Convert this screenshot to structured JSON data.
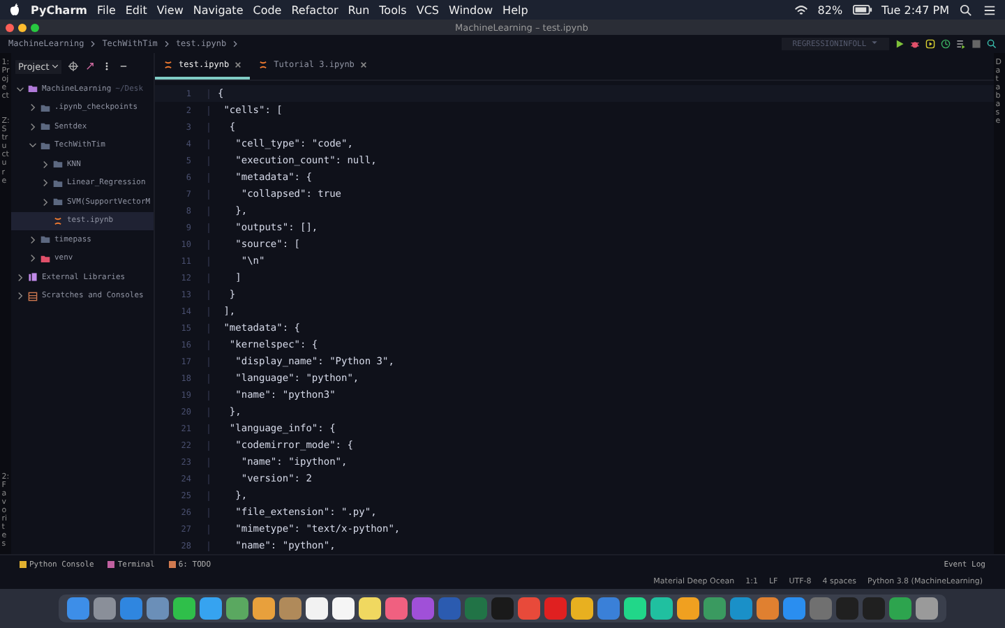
{
  "menu_bar": {
    "app": "PyCharm",
    "items": [
      "File",
      "Edit",
      "View",
      "Navigate",
      "Code",
      "Refactor",
      "Run",
      "Tools",
      "VCS",
      "Window",
      "Help"
    ],
    "battery": "82%",
    "clock": "Tue 2:47 PM"
  },
  "window": {
    "title": "MachineLearning – test.ipynb"
  },
  "breadcrumb": [
    "MachineLearning",
    "TechWithTim",
    "test.ipynb"
  ],
  "run_config": {
    "name": "REGRESSIONINFOLL"
  },
  "left_stripe": [
    "1: Project",
    "Z: Structure",
    "2: Favorites"
  ],
  "right_stripe": [
    "Database"
  ],
  "project_panel": {
    "title": "Project",
    "tree": [
      {
        "label": "MachineLearning",
        "hint": "~/Desk",
        "kind": "module",
        "expanded": true,
        "selected": false,
        "children": [
          {
            "label": ".ipynb_checkpoints",
            "kind": "folder",
            "expanded": false,
            "selected": false
          },
          {
            "label": "Sentdex",
            "kind": "folder",
            "expanded": false,
            "selected": false
          },
          {
            "label": "TechWithTim",
            "kind": "folder",
            "expanded": true,
            "selected": false,
            "children": [
              {
                "label": "KNN",
                "kind": "folder",
                "expanded": false,
                "selected": false
              },
              {
                "label": "Linear_Regression",
                "kind": "folder",
                "expanded": false,
                "selected": false
              },
              {
                "label": "SVM(SupportVectorM",
                "kind": "folder",
                "expanded": false,
                "selected": false
              },
              {
                "label": "test.ipynb",
                "kind": "notebook",
                "selected": true
              }
            ]
          },
          {
            "label": "timepass",
            "kind": "folder",
            "expanded": false,
            "selected": false
          },
          {
            "label": "venv",
            "kind": "venv",
            "expanded": false,
            "selected": false
          }
        ]
      },
      {
        "label": "External Libraries",
        "kind": "library",
        "expanded": false,
        "selected": false
      },
      {
        "label": "Scratches and Consoles",
        "kind": "scratches",
        "expanded": false,
        "selected": false
      }
    ]
  },
  "editor_tabs": [
    {
      "label": "test.ipynb",
      "selected": true
    },
    {
      "label": "Tutorial 3.ipynb",
      "selected": false
    }
  ],
  "code_lines": [
    {
      "number": "1",
      "text": "{"
    },
    {
      "number": "2",
      "text": " \"cells\": ["
    },
    {
      "number": "3",
      "text": "  {"
    },
    {
      "number": "4",
      "text": "   \"cell_type\": \"code\","
    },
    {
      "number": "5",
      "text": "   \"execution_count\": null,"
    },
    {
      "number": "6",
      "text": "   \"metadata\": {"
    },
    {
      "number": "7",
      "text": "    \"collapsed\": true"
    },
    {
      "number": "8",
      "text": "   },"
    },
    {
      "number": "9",
      "text": "   \"outputs\": [],"
    },
    {
      "number": "10",
      "text": "   \"source\": ["
    },
    {
      "number": "11",
      "text": "    \"\\n\""
    },
    {
      "number": "12",
      "text": "   ]"
    },
    {
      "number": "13",
      "text": "  }"
    },
    {
      "number": "14",
      "text": " ],"
    },
    {
      "number": "15",
      "text": " \"metadata\": {"
    },
    {
      "number": "16",
      "text": "  \"kernelspec\": {"
    },
    {
      "number": "17",
      "text": "   \"display_name\": \"Python 3\","
    },
    {
      "number": "18",
      "text": "   \"language\": \"python\","
    },
    {
      "number": "19",
      "text": "   \"name\": \"python3\""
    },
    {
      "number": "20",
      "text": "  },"
    },
    {
      "number": "21",
      "text": "  \"language_info\": {"
    },
    {
      "number": "22",
      "text": "   \"codemirror_mode\": {"
    },
    {
      "number": "23",
      "text": "    \"name\": \"ipython\","
    },
    {
      "number": "24",
      "text": "    \"version\": 2"
    },
    {
      "number": "25",
      "text": "   },"
    },
    {
      "number": "26",
      "text": "   \"file_extension\": \".py\","
    },
    {
      "number": "27",
      "text": "   \"mimetype\": \"text/x-python\","
    },
    {
      "number": "28",
      "text": "   \"name\": \"python\","
    }
  ],
  "tool_tabs": [
    {
      "label": "Python Console",
      "kind": "console"
    },
    {
      "label": "Terminal",
      "kind": "terminal"
    },
    {
      "label": "6: TODO",
      "kind": "todo"
    }
  ],
  "event_log": "Event Log",
  "status_bar": [
    "Material Deep Ocean",
    "1:1",
    "LF",
    "UTF-8",
    "4 spaces",
    "Python 3.8 (MachineLearning)"
  ],
  "dock": [
    {
      "color": "#3d8ee8"
    },
    {
      "color": "#8a8f99"
    },
    {
      "color": "#2f86e0"
    },
    {
      "color": "#6b8fb8"
    },
    {
      "color": "#2fbf4a"
    },
    {
      "color": "#36a3f0"
    },
    {
      "color": "#5aa860"
    },
    {
      "color": "#e8a03c"
    },
    {
      "color": "#b08a5a"
    },
    {
      "color": "#f2f2f2"
    },
    {
      "color": "#f5f5f5"
    },
    {
      "color": "#f0d860"
    },
    {
      "color": "#f06080"
    },
    {
      "color": "#a050d8"
    },
    {
      "color": "#2b5bb0"
    },
    {
      "color": "#217346"
    },
    {
      "color": "#1a1a1a"
    },
    {
      "color": "#e84a3a"
    },
    {
      "color": "#e02020"
    },
    {
      "color": "#e8b020"
    },
    {
      "color": "#3a80d8"
    },
    {
      "color": "#21d789"
    },
    {
      "color": "#20c0a0"
    },
    {
      "color": "#f0a020"
    },
    {
      "color": "#3a9a60"
    },
    {
      "color": "#1a90c8"
    },
    {
      "color": "#e08030"
    },
    {
      "color": "#2a8ef0"
    },
    {
      "color": "#707070"
    },
    {
      "color": "#202020"
    },
    {
      "color": "#202020"
    },
    {
      "color": "#2da44e"
    },
    {
      "color": "#9a9a9a"
    }
  ]
}
